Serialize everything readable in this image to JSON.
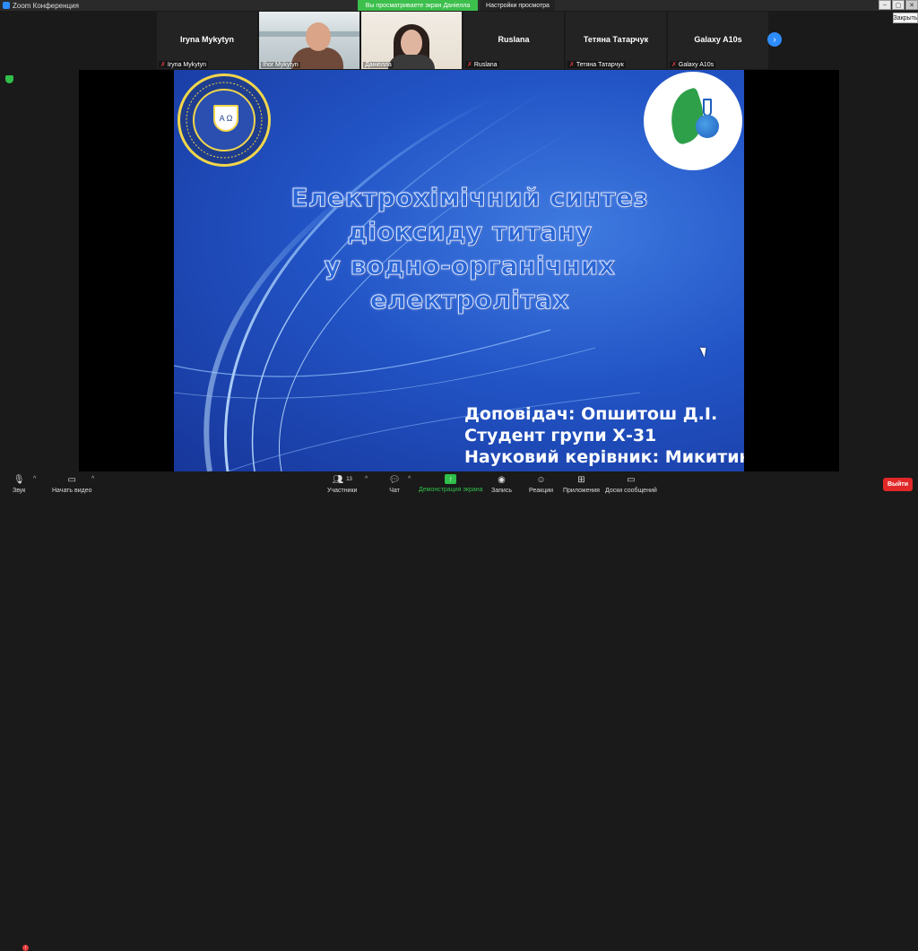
{
  "window": {
    "title": "Zoom Конференция",
    "share_banner": "Вы просматриваете экран Даніелла",
    "view_options": "Настройки просмотра",
    "close_tooltip": "Закрыть"
  },
  "gallery": {
    "tiles": [
      {
        "name": "Iryna Mykytyn",
        "label": "Iryna Mykytyn",
        "muted": true,
        "video": false
      },
      {
        "name": "",
        "label": "Ihor Mykytyn",
        "muted": false,
        "video": true
      },
      {
        "name": "",
        "label": "Даніелла",
        "muted": false,
        "video": true
      },
      {
        "name": "Ruslana",
        "label": "Ruslana",
        "muted": true,
        "video": false
      },
      {
        "name": "Тетяна Татарчук",
        "label": "Тетяна Татарчук",
        "muted": true,
        "video": false
      },
      {
        "name": "Galaxy A10s",
        "label": "Galaxy A10s",
        "muted": true,
        "video": false
      }
    ]
  },
  "slide": {
    "title_lines": [
      "Електрохімічний синтез",
      "діоксиду титану",
      "у водно-органічних",
      "електролітах"
    ],
    "presenter_lines": [
      "Доповідач: Опшитош Д.І.",
      "Студент групи Х-31",
      "Науковий керівник: Микитин І. М."
    ],
    "left_logo_letters": "Α Ω"
  },
  "toolbar": {
    "audio": "Звук",
    "video": "Начать видео",
    "participants": "Участники",
    "participants_count": "13",
    "chat": "Чат",
    "share": "Демонстрация экрана",
    "record": "Запись",
    "reactions": "Реакции",
    "apps": "Приложения",
    "whiteboards": "Доски сообщений",
    "leave": "Выйти"
  },
  "colors": {
    "share_green": "#3cbf4c",
    "leave_red": "#e02828",
    "zoom_blue": "#2d8cff"
  }
}
